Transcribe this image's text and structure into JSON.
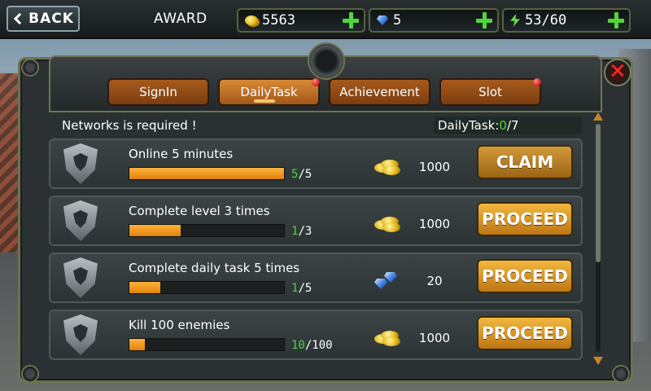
{
  "header": {
    "back_label": "BACK",
    "title": "AWARD",
    "resources": [
      {
        "icon": "coin-icon",
        "value": "5563"
      },
      {
        "icon": "gem-icon",
        "value": "5"
      },
      {
        "icon": "energy-icon",
        "value": "53/60"
      }
    ]
  },
  "tabs": [
    {
      "label": "SignIn",
      "active": false,
      "badge": false
    },
    {
      "label": "DailyTask",
      "active": true,
      "badge": true
    },
    {
      "label": "Achievement",
      "active": false,
      "badge": false
    },
    {
      "label": "Slot",
      "active": false,
      "badge": true
    }
  ],
  "notice": "Networks is required !",
  "daily_task": {
    "label": "DailyTask:",
    "done": "0",
    "total": "/7"
  },
  "tasks": [
    {
      "title": "Online 5 minutes",
      "current": "5",
      "total": "/5",
      "fraction": 1.0,
      "reward_icon": "coins-icon",
      "reward": "1000",
      "action": "CLAIM",
      "icon": "hourglass-shield-icon"
    },
    {
      "title": "Complete level 3 times",
      "current": "1",
      "total": "/3",
      "fraction": 0.33,
      "reward_icon": "coins-icon",
      "reward": "1000",
      "action": "PROCEED",
      "icon": "winged-shield-icon"
    },
    {
      "title": "Complete daily task 5 times",
      "current": "1",
      "total": "/5",
      "fraction": 0.2,
      "reward_icon": "gems-icon",
      "reward": "20",
      "action": "PROCEED",
      "icon": "eagle-shield-icon"
    },
    {
      "title": "Kill 100 enemies",
      "current": "10",
      "total": "/100",
      "fraction": 0.1,
      "reward_icon": "coins-icon",
      "reward": "1000",
      "action": "PROCEED",
      "icon": "weapons-shield-icon"
    }
  ],
  "colors": {
    "accent_green": "#51d63a",
    "button_orange": "#f3b83f",
    "tab_brown": "#a65a1c",
    "close_red": "#ff2a2a"
  }
}
